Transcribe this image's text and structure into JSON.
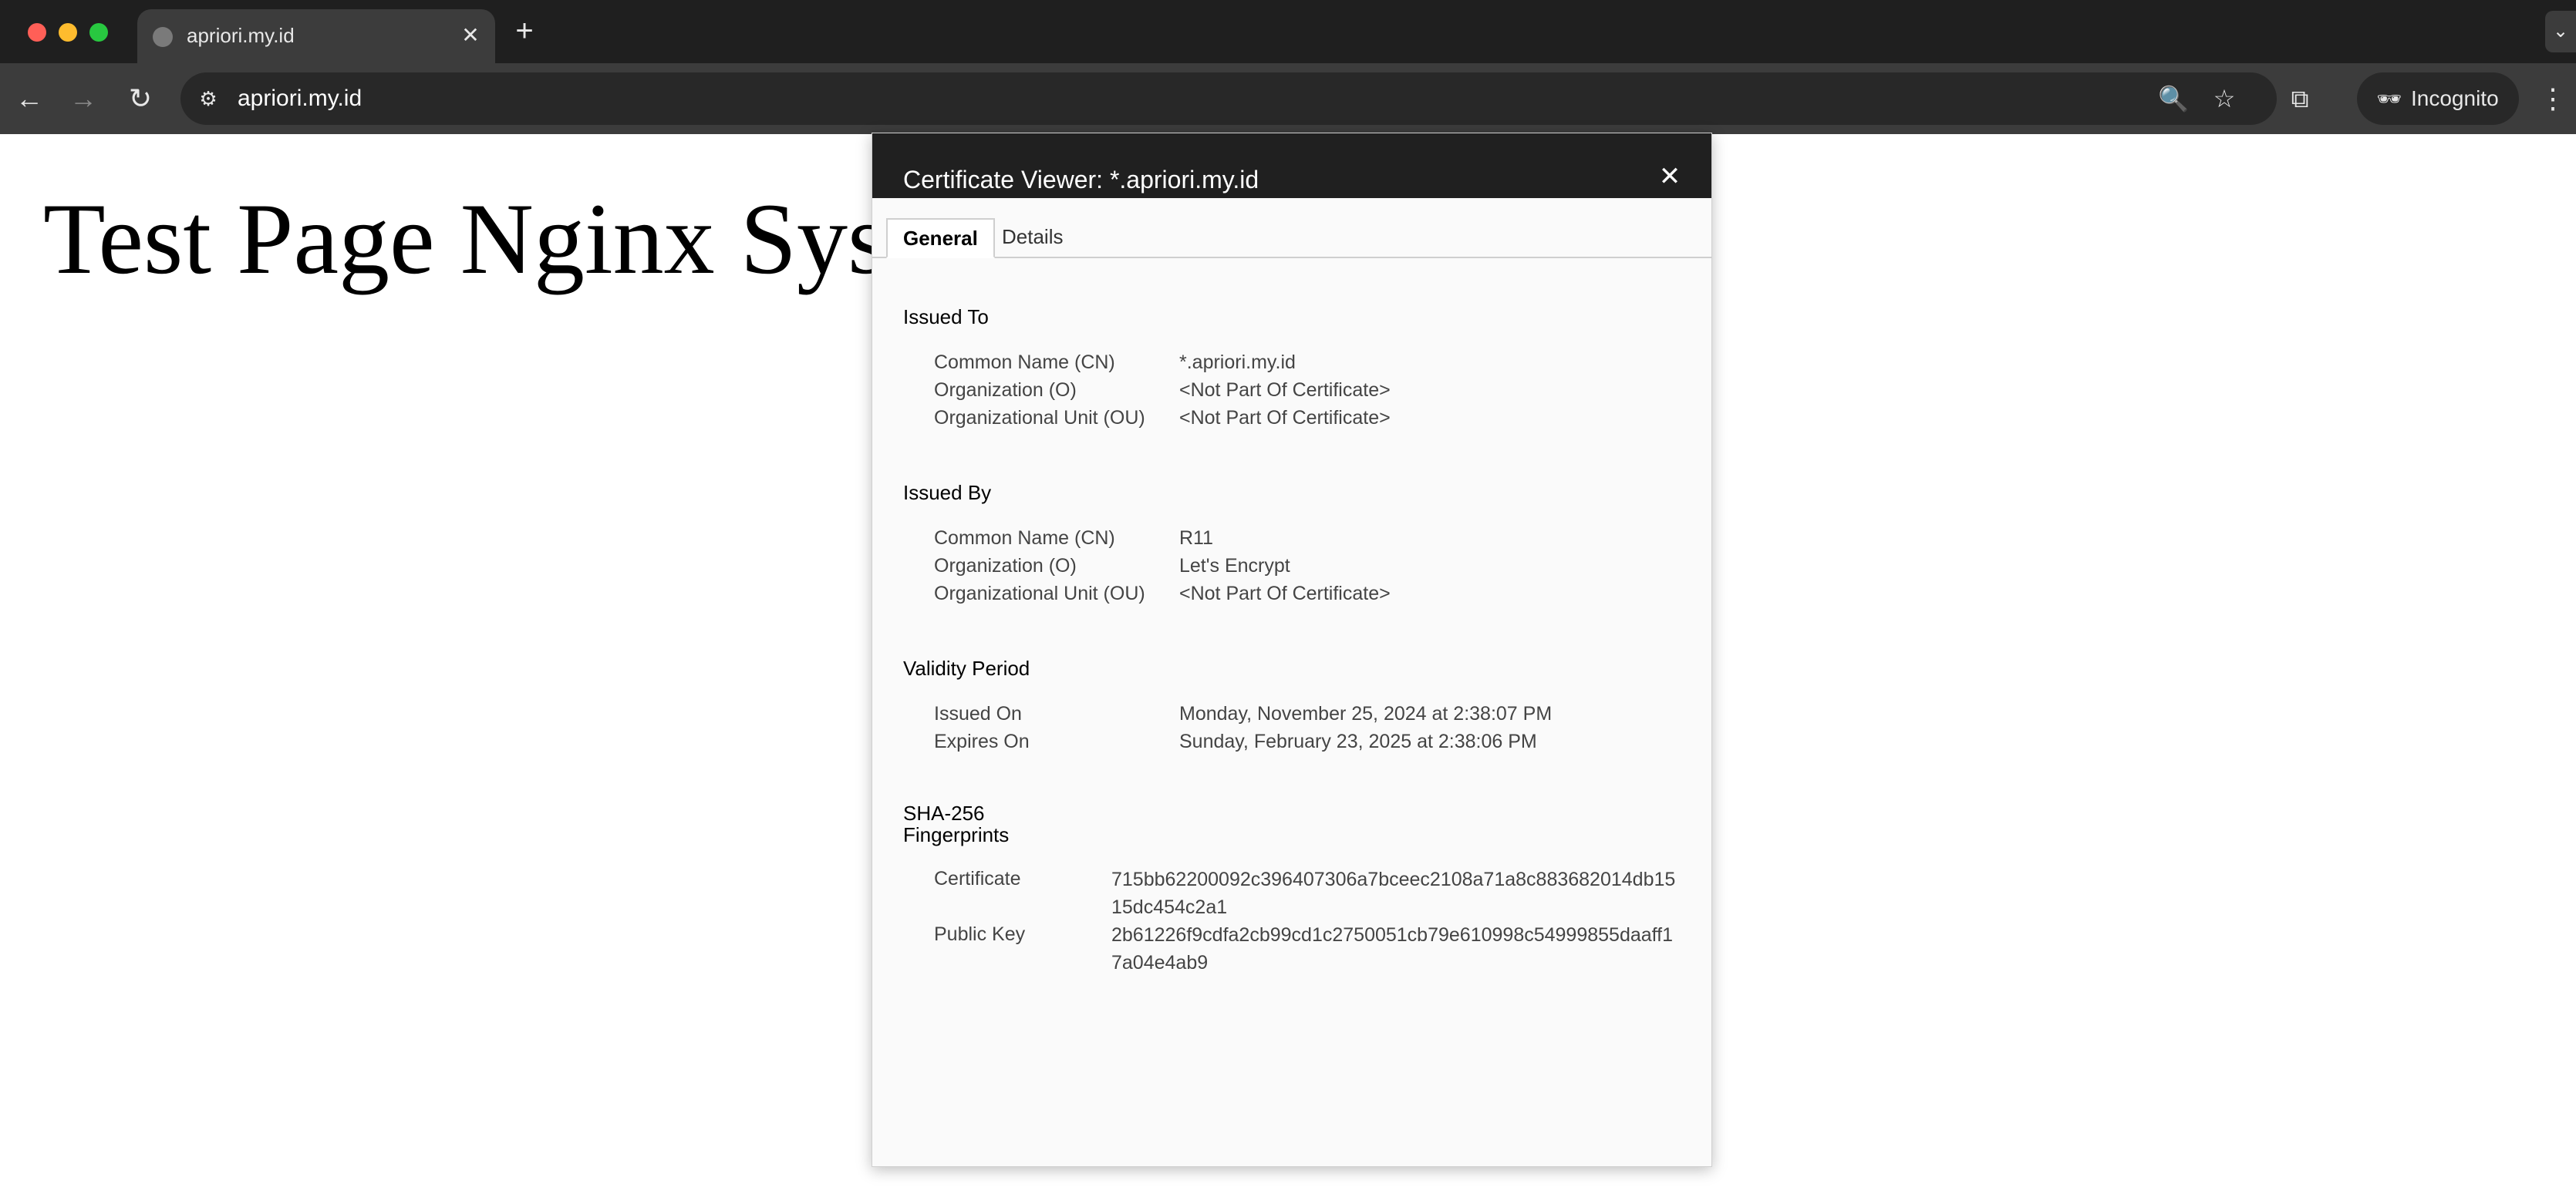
{
  "browser": {
    "tab": {
      "title": "apriori.my.id",
      "close": "✕"
    },
    "new_tab": "+",
    "tab_search": "⌄",
    "nav": {
      "back": "←",
      "forward": "→",
      "reload": "↻"
    },
    "omnibox": {
      "site_info": "⚙",
      "url": "apriori.my.id"
    },
    "icons": {
      "zoom": "🔍",
      "bookmark": "☆",
      "extensions": "⧉",
      "menu": "⋮"
    },
    "incognito": {
      "icon": "🕶",
      "label": "Incognito"
    },
    "colors": {
      "close": "#ff5f57",
      "minimize": "#febc2e",
      "maximize": "#28c840"
    }
  },
  "page": {
    "heading": "Test Page Nginx Syst"
  },
  "dialog": {
    "title": "Certificate Viewer: *.apriori.my.id",
    "close": "✕",
    "tabs": [
      {
        "label": "General"
      },
      {
        "label": "Details"
      }
    ],
    "issued_to": {
      "title": "Issued To",
      "rows": [
        {
          "label": "Common Name (CN)",
          "value": "*.apriori.my.id"
        },
        {
          "label": "Organization (O)",
          "value": "<Not Part Of Certificate>"
        },
        {
          "label": "Organizational Unit (OU)",
          "value": "<Not Part Of Certificate>"
        }
      ]
    },
    "issued_by": {
      "title": "Issued By",
      "rows": [
        {
          "label": "Common Name (CN)",
          "value": "R11"
        },
        {
          "label": "Organization (O)",
          "value": "Let's Encrypt"
        },
        {
          "label": "Organizational Unit (OU)",
          "value": "<Not Part Of Certificate>"
        }
      ]
    },
    "validity": {
      "title": "Validity Period",
      "rows": [
        {
          "label": "Issued On",
          "value": "Monday, November 25, 2024 at 2:38:07 PM"
        },
        {
          "label": "Expires On",
          "value": "Sunday, February 23, 2025 at 2:38:06 PM"
        }
      ]
    },
    "fingerprints": {
      "title_line1": "SHA-256",
      "title_line2": "Fingerprints",
      "rows": [
        {
          "label": "Certificate",
          "value": "715bb62200092c396407306a7bceec2108a71a8c883682014db1515dc454c2a1"
        },
        {
          "label": "Public Key",
          "value": "2b61226f9cdfa2cb99cd1c2750051cb79e610998c54999855daaff17a04e4ab9"
        }
      ]
    }
  }
}
